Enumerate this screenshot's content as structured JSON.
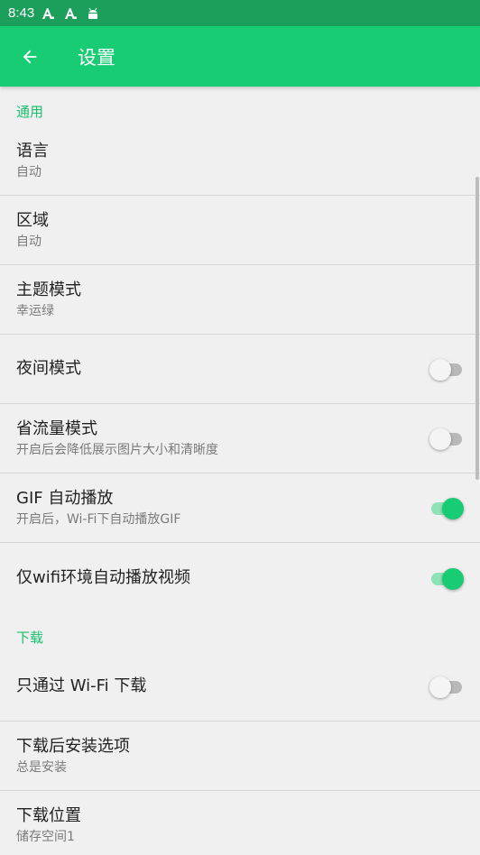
{
  "status_bar": {
    "time": "8:43",
    "icons": [
      "a-notification-icon",
      "a-notification-icon",
      "android-icon"
    ]
  },
  "app_bar": {
    "title": "设置",
    "back_icon": "arrow-left-icon"
  },
  "sections": {
    "general": {
      "header": "通用",
      "language": {
        "title": "语言",
        "value": "自动"
      },
      "region": {
        "title": "区域",
        "value": "自动"
      },
      "theme": {
        "title": "主题模式",
        "value": "幸运绿"
      },
      "night_mode": {
        "title": "夜间模式",
        "enabled": false
      },
      "data_saver": {
        "title": "省流量模式",
        "description": "开启后会降低展示图片大小和清晰度",
        "enabled": false
      },
      "gif_autoplay": {
        "title": "GIF 自动播放",
        "description": "开启后，Wi-Fi下自动播放GIF",
        "enabled": true
      },
      "wifi_video": {
        "title": "仅wifi环境自动播放视频",
        "enabled": true
      }
    },
    "download": {
      "header": "下载",
      "wifi_only": {
        "title": "只通过 Wi-Fi 下载",
        "enabled": false
      },
      "install_option": {
        "title": "下载后安装选项",
        "value": "总是安装"
      },
      "location": {
        "title": "下载位置",
        "value": "储存空间1"
      }
    }
  },
  "colors": {
    "status_bar": "#1d9f5c",
    "app_bar": "#17cc73",
    "accent": "#17c16d",
    "background": "#f0f0f0"
  }
}
